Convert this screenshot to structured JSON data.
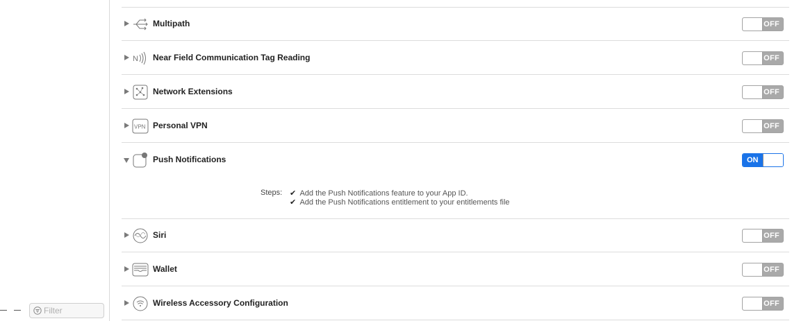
{
  "filter": {
    "placeholder": "Filter"
  },
  "capabilities": [
    {
      "title": "Multipath",
      "icon": "multipath-icon",
      "state": "OFF",
      "expanded": false
    },
    {
      "title": "Near Field Communication Tag Reading",
      "icon": "nfc-icon",
      "state": "OFF",
      "expanded": false
    },
    {
      "title": "Network Extensions",
      "icon": "network-extensions-icon",
      "state": "OFF",
      "expanded": false
    },
    {
      "title": "Personal VPN",
      "icon": "vpn-icon",
      "state": "OFF",
      "expanded": false
    },
    {
      "title": "Push Notifications",
      "icon": "push-notifications-icon",
      "state": "ON",
      "expanded": true
    },
    {
      "title": "Siri",
      "icon": "siri-icon",
      "state": "OFF",
      "expanded": false
    },
    {
      "title": "Wallet",
      "icon": "wallet-icon",
      "state": "OFF",
      "expanded": false
    },
    {
      "title": "Wireless Accessory Configuration",
      "icon": "wireless-accessory-icon",
      "state": "OFF",
      "expanded": false
    }
  ],
  "push_notifications_steps": {
    "label": "Steps:",
    "items": [
      "Add the Push Notifications feature to your App ID.",
      "Add the Push Notifications entitlement to your entitlements file"
    ]
  },
  "colors": {
    "accent": "#1a73e8",
    "toggle_off": "#a9a9a9",
    "divider": "#dcdcdc"
  }
}
